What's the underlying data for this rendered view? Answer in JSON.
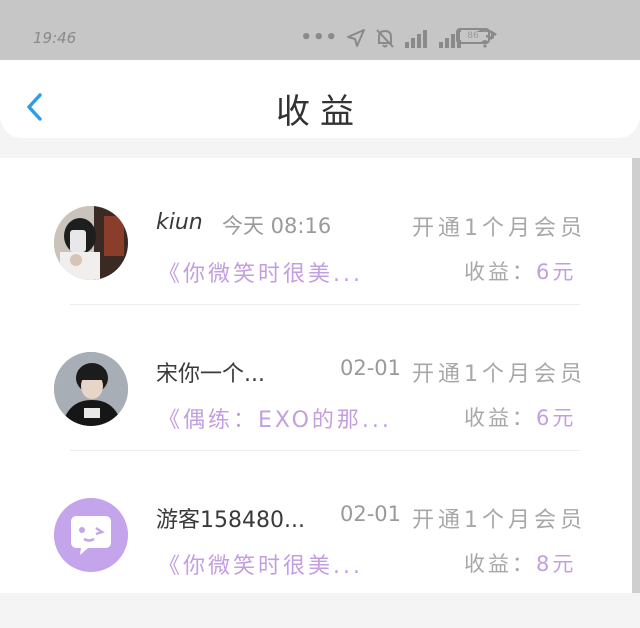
{
  "status_bar": {
    "time": "19:46",
    "battery": "86"
  },
  "header": {
    "title": "收益"
  },
  "records": [
    {
      "name": "kiun",
      "time": "今天 08:16",
      "action": "开通1个月会员",
      "book": "《你微笑时很美...",
      "earn_label": "收益：",
      "earn_value": "6元"
    },
    {
      "name": "宋你一个...",
      "time": "02-01",
      "action": "开通1个月会员",
      "book": "《偶练：EXO的那...",
      "earn_label": "收益：",
      "earn_value": "6元"
    },
    {
      "name": "游客158480...",
      "time": "02-01",
      "action": "开通1个月会员",
      "book": "《你微笑时很美...",
      "earn_label": "收益：",
      "earn_value": "8元"
    }
  ],
  "colors": {
    "accent": "#c39ee0",
    "back_arrow": "#2e9fe6",
    "status_bar": "#c6c6c6"
  },
  "icons": [
    "back-icon",
    "dots-icon",
    "location-icon",
    "mute-icon",
    "signal-icon",
    "wifi-icon",
    "battery-icon",
    "guest-avatar-icon"
  ]
}
